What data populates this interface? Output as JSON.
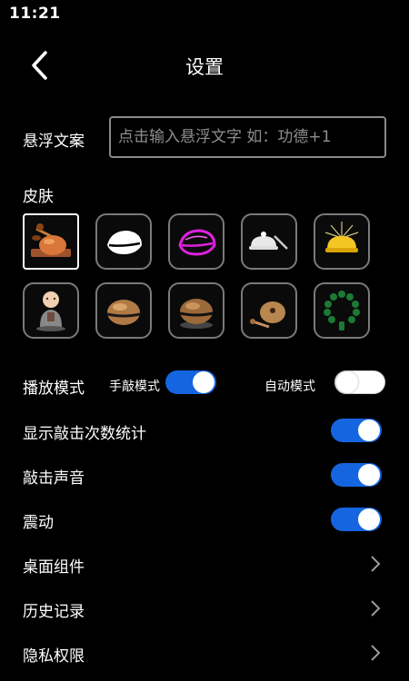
{
  "status_bar": {
    "time": "11:21"
  },
  "header": {
    "title": "设置",
    "back_icon": "chevron-left-icon"
  },
  "float_text": {
    "label": "悬浮文案",
    "placeholder": "点击输入悬浮文字 如：功德+1",
    "value": ""
  },
  "skins": {
    "label": "皮肤",
    "selected_index": 0,
    "items": [
      {
        "icon": "woodfish-mallet-icon"
      },
      {
        "icon": "white-woodfish-icon"
      },
      {
        "icon": "neon-woodfish-icon"
      },
      {
        "icon": "bowl-mallet-icon"
      },
      {
        "icon": "golden-glow-bowl-icon"
      },
      {
        "icon": "monk-figure-icon"
      },
      {
        "icon": "wooden-woodfish-icon"
      },
      {
        "icon": "dark-woodfish-icon"
      },
      {
        "icon": "gourd-woodfish-icon"
      },
      {
        "icon": "prayer-beads-icon"
      }
    ]
  },
  "play_mode": {
    "label": "播放模式",
    "manual": {
      "label": "手敲模式",
      "on": true
    },
    "auto": {
      "label": "自动模式",
      "on": false
    }
  },
  "toggles": [
    {
      "label": "显示敲击次数统计",
      "on": true
    },
    {
      "label": "敲击声音",
      "on": true
    },
    {
      "label": "震动",
      "on": true
    }
  ],
  "links": [
    {
      "label": "桌面组件",
      "icon": "chevron-right-icon"
    },
    {
      "label": "历史记录",
      "icon": "chevron-right-icon"
    },
    {
      "label": "隐私权限",
      "icon": "chevron-right-icon"
    }
  ],
  "colors": {
    "background": "#000000",
    "toggle_on": "#1565e0",
    "border": "#8a8a8a"
  }
}
